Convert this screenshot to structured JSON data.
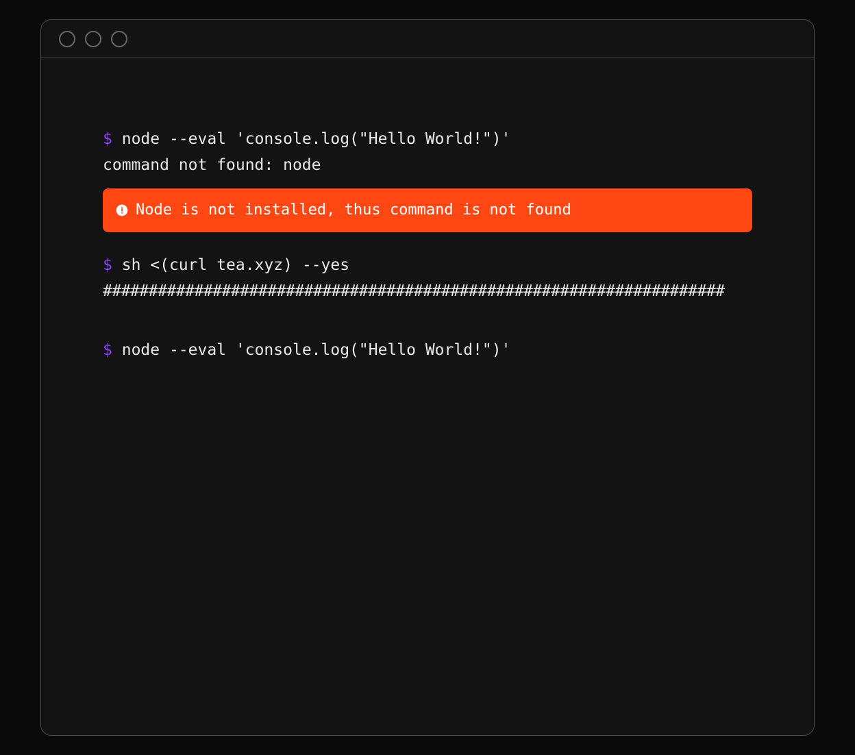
{
  "colors": {
    "prompt": "#8a3ffc",
    "text": "#e8e8e8",
    "alert_bg": "#ff4713",
    "alert_fg": "#ffffff",
    "window_bg": "#131313",
    "border": "#4a4a4a"
  },
  "prompt_symbol": "$",
  "terminal": {
    "block1": {
      "command": "node --eval 'console.log(\"Hello World!\")'",
      "output": "command not found: node"
    },
    "alert": {
      "icon": "alert-icon",
      "text": "Node is not installed, thus command is not found"
    },
    "block2": {
      "command": "sh <(curl tea.xyz) --yes",
      "progress": "####################################################################"
    },
    "block3": {
      "command": "node --eval 'console.log(\"Hello World!\")'"
    }
  }
}
